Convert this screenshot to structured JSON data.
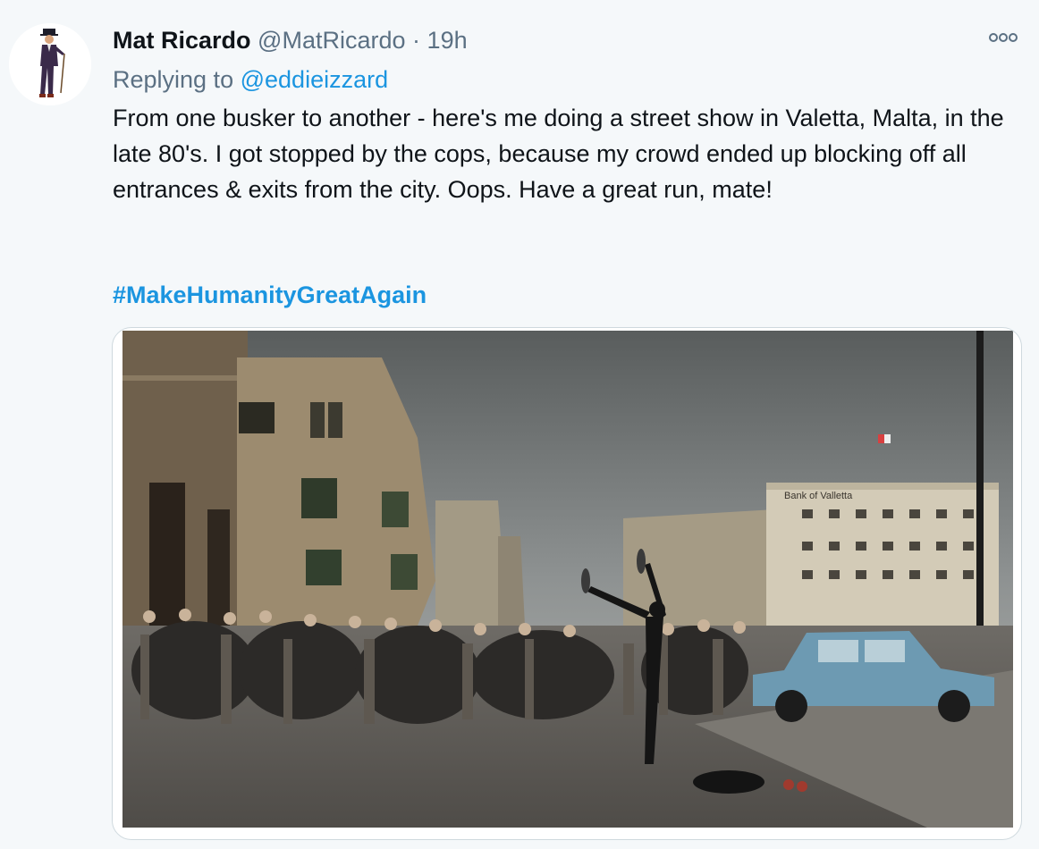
{
  "tweet": {
    "author": {
      "name": "Mat Ricardo",
      "handle": "@MatRicardo",
      "separator": "·",
      "time": "19h"
    },
    "reply": {
      "prefix": "Replying to",
      "to": "@eddieizzard"
    },
    "text": "From one busker to another - here's me doing a street show in Valetta, Malta, in the late 80's. I got stopped by the cops, because my crowd ended up blocking off all entrances & exits from the city. Oops. Have a great run, mate!",
    "hashtag": "#MakeHumanityGreatAgain",
    "media": {
      "sign_text": "Bank of Valletta"
    }
  },
  "icons": {
    "more": "more-dots-icon"
  },
  "colors": {
    "link": "#1b95e0",
    "muted": "#5b7083",
    "text": "#0f1419",
    "background": "#f5f8fa"
  }
}
